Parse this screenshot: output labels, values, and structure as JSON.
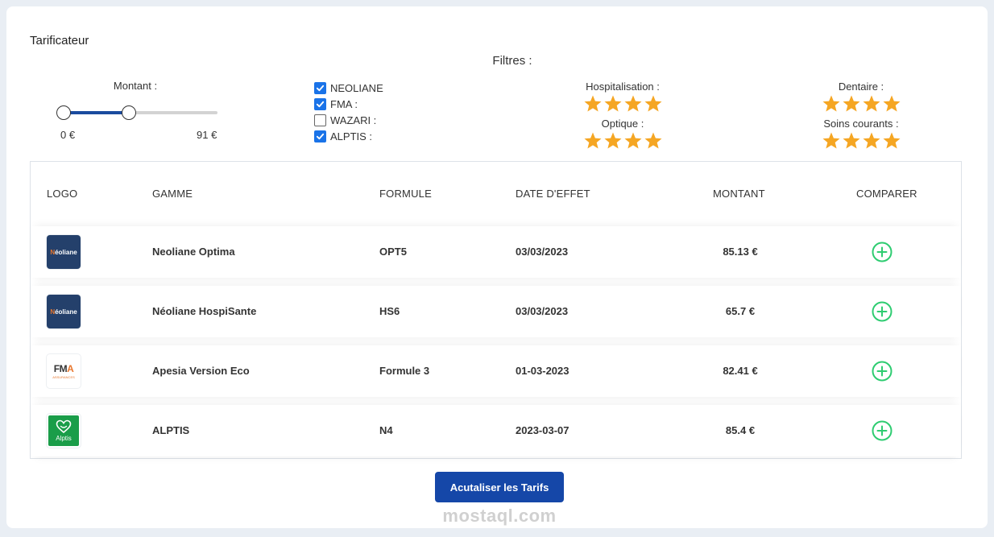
{
  "header": {
    "title": "Tarificateur",
    "filters_title": "Filtres :"
  },
  "montant_filter": {
    "label": "Montant :",
    "min_label": "0 €",
    "max_label": "91 €"
  },
  "insurers": [
    {
      "label": "NEOLIANE",
      "checked": true
    },
    {
      "label": "FMA :",
      "checked": true
    },
    {
      "label": "WAZARI :",
      "checked": false
    },
    {
      "label": "ALPTIS :",
      "checked": true
    }
  ],
  "ratings": {
    "hospitalisation": {
      "label": "Hospitalisation :",
      "stars": 4
    },
    "optique": {
      "label": "Optique :",
      "stars": 4
    },
    "dentaire": {
      "label": "Dentaire :",
      "stars": 4
    },
    "soins_courants": {
      "label": "Soins courants :",
      "stars": 4
    }
  },
  "table": {
    "columns": [
      "LOGO",
      "GAMME",
      "FORMULE",
      "DATE D'EFFET",
      "MONTANT",
      "COMPARER"
    ],
    "rows": [
      {
        "logo": "neoliane",
        "logo_text": "éoliane",
        "logo_initial": "N",
        "gamme": "Neoliane Optima",
        "formule": "OPT5",
        "date": "03/03/2023",
        "montant": "85.13 €"
      },
      {
        "logo": "neoliane",
        "logo_text": "éoliane",
        "logo_initial": "N",
        "gamme": "Néoliane HospiSante",
        "formule": "HS6",
        "date": "03/03/2023",
        "montant": "65.7 €"
      },
      {
        "logo": "fma",
        "logo_text": "FM",
        "logo_initial": "A",
        "logo_sub": "ASSURANCES",
        "gamme": "Apesia Version Eco",
        "formule": "Formule 3",
        "date": "01-03-2023",
        "montant": "82.41 €"
      },
      {
        "logo": "alptis",
        "logo_text": "Alptis",
        "gamme": "ALPTIS",
        "formule": "N4",
        "date": "2023-03-07",
        "montant": "85.4 €"
      }
    ]
  },
  "actions": {
    "refresh_label": "Acutaliser les Tarifs"
  },
  "watermark": "mostaql.com",
  "colors": {
    "accent": "#1547a8",
    "star": "#f5a623",
    "compare": "#2ecc71",
    "checkbox": "#1a73e8"
  }
}
